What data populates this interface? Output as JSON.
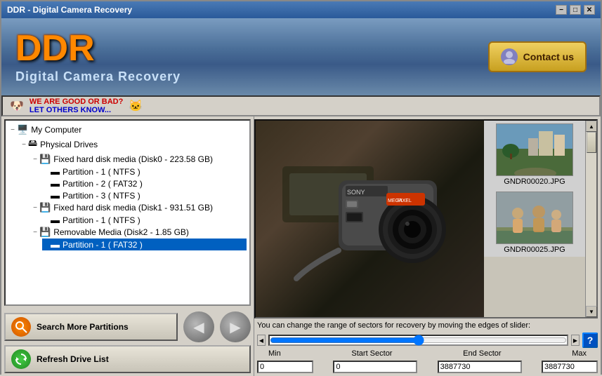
{
  "window": {
    "title": "DDR - Digital Camera Recovery",
    "minimize_label": "−",
    "maximize_label": "□",
    "close_label": "✕"
  },
  "header": {
    "logo": "DDR",
    "subtitle": "Digital Camera Recovery",
    "contact_label": "Contact us"
  },
  "rating": {
    "text1": "WE ARE GOOD OR BAD?",
    "text2": "LET OTHERS KNOW..."
  },
  "tree": {
    "root": "My Computer",
    "physical_drives": "Physical Drives",
    "disk0": "Fixed hard disk media (Disk0 - 223.58 GB)",
    "disk0_p1": "Partition - 1 ( NTFS )",
    "disk0_p2": "Partition - 2 ( FAT32 )",
    "disk0_p3": "Partition - 3 ( NTFS )",
    "disk1": "Fixed hard disk media (Disk1 - 931.51 GB)",
    "disk1_p1": "Partition - 1 ( NTFS )",
    "disk2": "Removable Media (Disk2 - 1.85 GB)",
    "disk2_p1": "Partition - 1 ( FAT32 )"
  },
  "buttons": {
    "search_partitions": "Search More Partitions",
    "refresh_drives": "Refresh Drive List",
    "prev_label": "◀",
    "next_label": "▶"
  },
  "thumbnails": [
    {
      "name": "GNDR00020.JPG"
    },
    {
      "name": "GNDR00025.JPG"
    }
  ],
  "slider": {
    "description": "You can change the range of sectors for recovery by moving the edges of slider:",
    "min_label": "Min",
    "start_label": "Start Sector",
    "end_label": "End Sector",
    "max_label": "Max",
    "min_value": "0",
    "start_value": "0",
    "end_value": "3887730",
    "max_value": "3887730",
    "help_label": "?"
  }
}
